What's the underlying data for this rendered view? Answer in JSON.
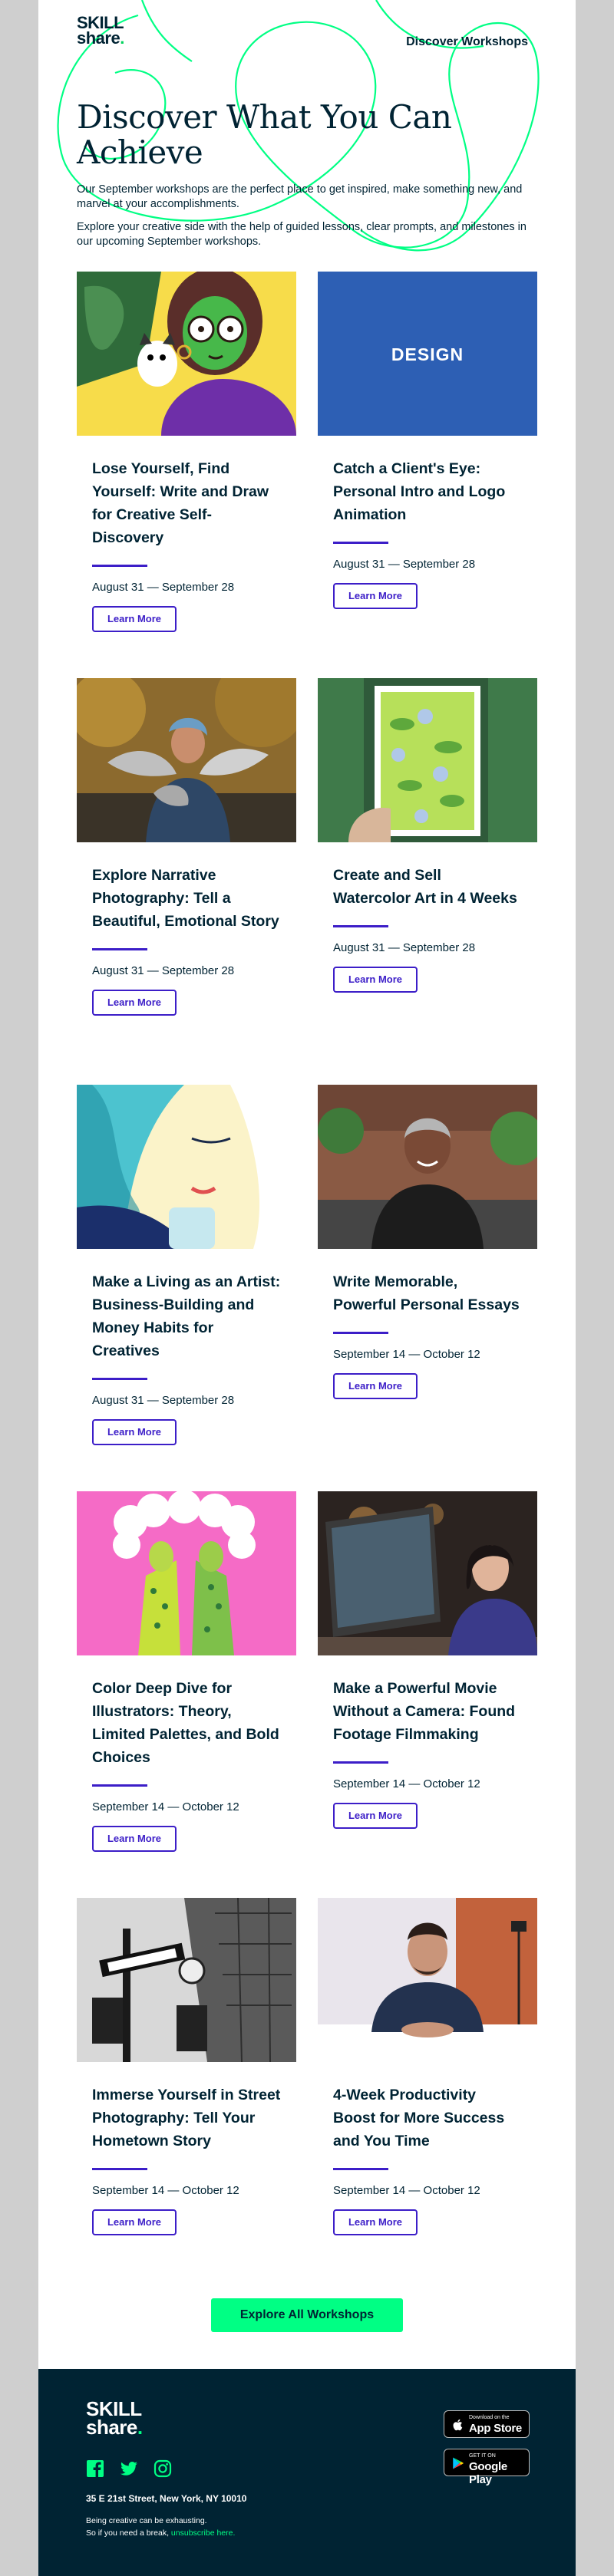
{
  "brand": {
    "logo_line1": "SKILL",
    "logo_line2": "share",
    "logo_dot": "."
  },
  "header": {
    "nav_link": "Discover Workshops"
  },
  "hero": {
    "title": "Discover What You Can Achieve",
    "paragraph1": "Our September workshops are the perfect place to get inspired, make something new, and marvel at your accomplishments.",
    "paragraph2": "Explore your creative side with the help of guided lessons, clear prompts, and milestones in our upcoming September workshops."
  },
  "workshops": [
    {
      "title": "Lose Yourself, Find Yourself: Write and Draw for Creative Self-Discovery",
      "dates": "August 31 — September 28",
      "button": "Learn More"
    },
    {
      "title": "Catch a Client's Eye: Personal Intro and Logo Animation",
      "dates": "August 31 — September 28",
      "button": "Learn More",
      "image_text": "DESIGN"
    },
    {
      "title": "Explore Narrative Photography: Tell a Beautiful, Emotional Story",
      "dates": "August 31 — September 28",
      "button": "Learn More"
    },
    {
      "title": "Create and Sell Watercolor Art in 4 Weeks",
      "dates": "August 31 — September 28",
      "button": "Learn More"
    },
    {
      "title": "Make a Living as an Artist: Business-Building and Money Habits for Creatives",
      "dates": "August 31 — September 28",
      "button": "Learn More"
    },
    {
      "title": "Write Memorable, Powerful Personal Essays",
      "dates": "September 14 — October 12",
      "button": "Learn More"
    },
    {
      "title": "Color Deep Dive for Illustrators: Theory, Limited Palettes, and Bold Choices",
      "dates": "September 14 — October 12",
      "button": "Learn More"
    },
    {
      "title": "Make a Powerful Movie Without a Camera: Found Footage Filmmaking",
      "dates": "September 14 — October 12",
      "button": "Learn More"
    },
    {
      "title": "Immerse Yourself in Street Photography: Tell Your Hometown Story",
      "dates": "September 14 — October 12",
      "button": "Learn More"
    },
    {
      "title": "4-Week Productivity Boost for More Success and You Time",
      "dates": "September 14 — October 12",
      "button": "Learn More"
    }
  ],
  "cta": {
    "label": "Explore All Workshops"
  },
  "footer": {
    "address": "35 E 21st Street, New York, NY 10010",
    "fine_print_1": "Being creative can be exhausting.",
    "fine_print_2": "So if you need a break,",
    "unsubscribe": "unsubscribe here.",
    "app_store_small": "Download on the",
    "app_store_big": "App Store",
    "google_play_small": "GET IT ON",
    "google_play_big": "Google Play",
    "social_icons": [
      "facebook-icon",
      "twitter-icon",
      "instagram-icon"
    ]
  },
  "colors": {
    "accent": "#3c1ec8",
    "brand_green": "#00ff84",
    "navy": "#002333"
  }
}
